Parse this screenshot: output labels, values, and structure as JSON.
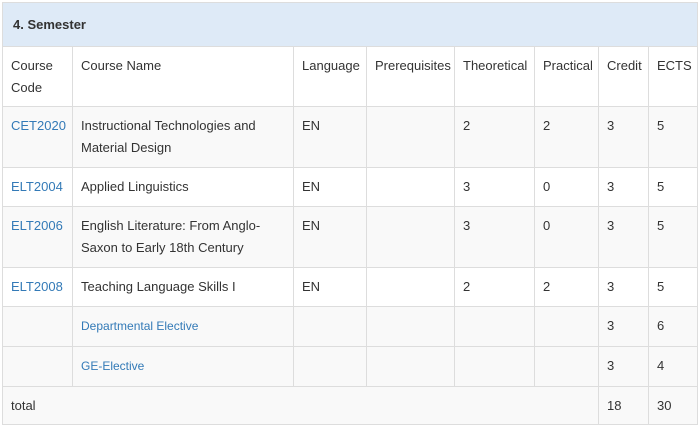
{
  "semester_title": "4. Semester",
  "headers": {
    "code": "Course Code",
    "name": "Course Name",
    "language": "Language",
    "prereq": "Prerequisites",
    "theoretical": "Theoretical",
    "practical": "Practical",
    "credit": "Credit",
    "ects": "ECTS"
  },
  "courses": [
    {
      "code": "CET2020",
      "name": "Instructional Technologies and Material Design",
      "language": "EN",
      "prereq": "",
      "theoretical": "2",
      "practical": "2",
      "credit": "3",
      "ects": "5"
    },
    {
      "code": "ELT2004",
      "name": "Applied Linguistics",
      "language": "EN",
      "prereq": "",
      "theoretical": "3",
      "practical": "0",
      "credit": "3",
      "ects": "5"
    },
    {
      "code": "ELT2006",
      "name": "English Literature: From Anglo-Saxon to Early 18th Century",
      "language": "EN",
      "prereq": "",
      "theoretical": "3",
      "practical": "0",
      "credit": "3",
      "ects": "5"
    },
    {
      "code": "ELT2008",
      "name": "Teaching Language Skills I",
      "language": "EN",
      "prereq": "",
      "theoretical": "2",
      "practical": "2",
      "credit": "3",
      "ects": "5"
    }
  ],
  "electives": [
    {
      "name": "Departmental Elective",
      "credit": "3",
      "ects": "6"
    },
    {
      "name": "GE-Elective",
      "credit": "3",
      "ects": "4"
    }
  ],
  "total": {
    "label": "total",
    "credit": "18",
    "ects": "30"
  },
  "colors": {
    "link": "#337ab7",
    "header_bg": "#deeaf7",
    "border": "#dddddd",
    "stripe": "#f9f9f9"
  }
}
